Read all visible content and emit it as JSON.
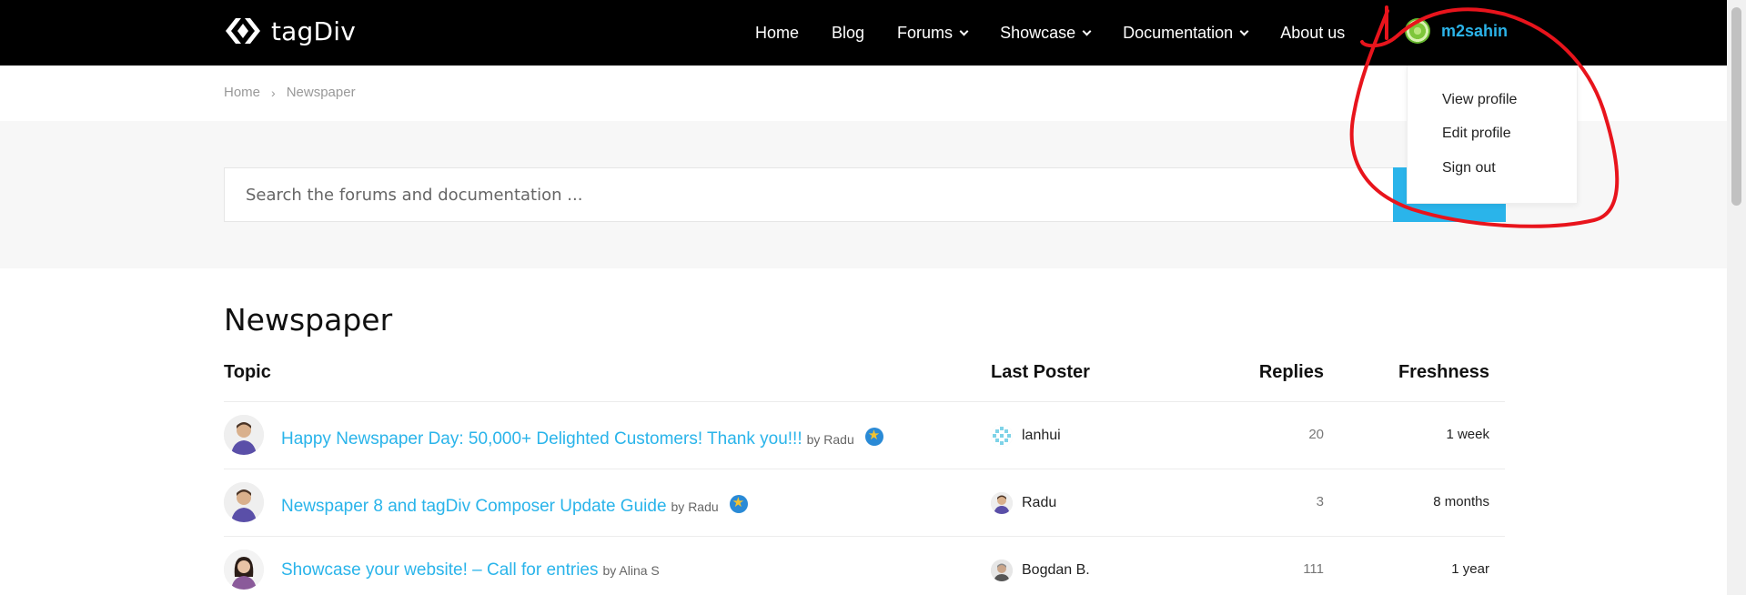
{
  "brand": {
    "name": "tagDiv"
  },
  "nav": {
    "items": [
      {
        "label": "Home",
        "dropdown": false
      },
      {
        "label": "Blog",
        "dropdown": false
      },
      {
        "label": "Forums",
        "dropdown": true
      },
      {
        "label": "Showcase",
        "dropdown": true
      },
      {
        "label": "Documentation",
        "dropdown": true
      },
      {
        "label": "About us",
        "dropdown": false
      }
    ]
  },
  "user": {
    "name": "m2sahin",
    "menu": [
      "View profile",
      "Edit profile",
      "Sign out"
    ]
  },
  "breadcrumb": {
    "home": "Home",
    "current": "Newspaper"
  },
  "search": {
    "placeholder": "Search the forums and documentation ..."
  },
  "page": {
    "title": "Newspaper"
  },
  "table": {
    "headers": {
      "topic": "Topic",
      "poster": "Last Poster",
      "replies": "Replies",
      "freshness": "Freshness"
    },
    "rows": [
      {
        "title": "Happy Newspaper Day: 50,000+ Delighted Customers! Thank you!!!",
        "by": "by Radu",
        "starred": true,
        "last_poster": "lanhui",
        "replies": "20",
        "freshness": "1 week"
      },
      {
        "title": "Newspaper 8 and tagDiv Composer Update Guide",
        "by": "by Radu",
        "starred": true,
        "last_poster": "Radu",
        "replies": "3",
        "freshness": "8 months"
      },
      {
        "title": "Showcase your website! – Call for entries",
        "by": "by Alina S",
        "starred": false,
        "last_poster": "Bogdan B.",
        "replies": "111",
        "freshness": "1 year"
      }
    ]
  },
  "colors": {
    "accent": "#2ab4ea",
    "topbar": "#000000",
    "annotation": "#e8141c"
  },
  "icons": {
    "logo": "tagdiv-logo-icon",
    "dropdown": "chevron-down-icon",
    "starred": "star-badge-icon"
  }
}
